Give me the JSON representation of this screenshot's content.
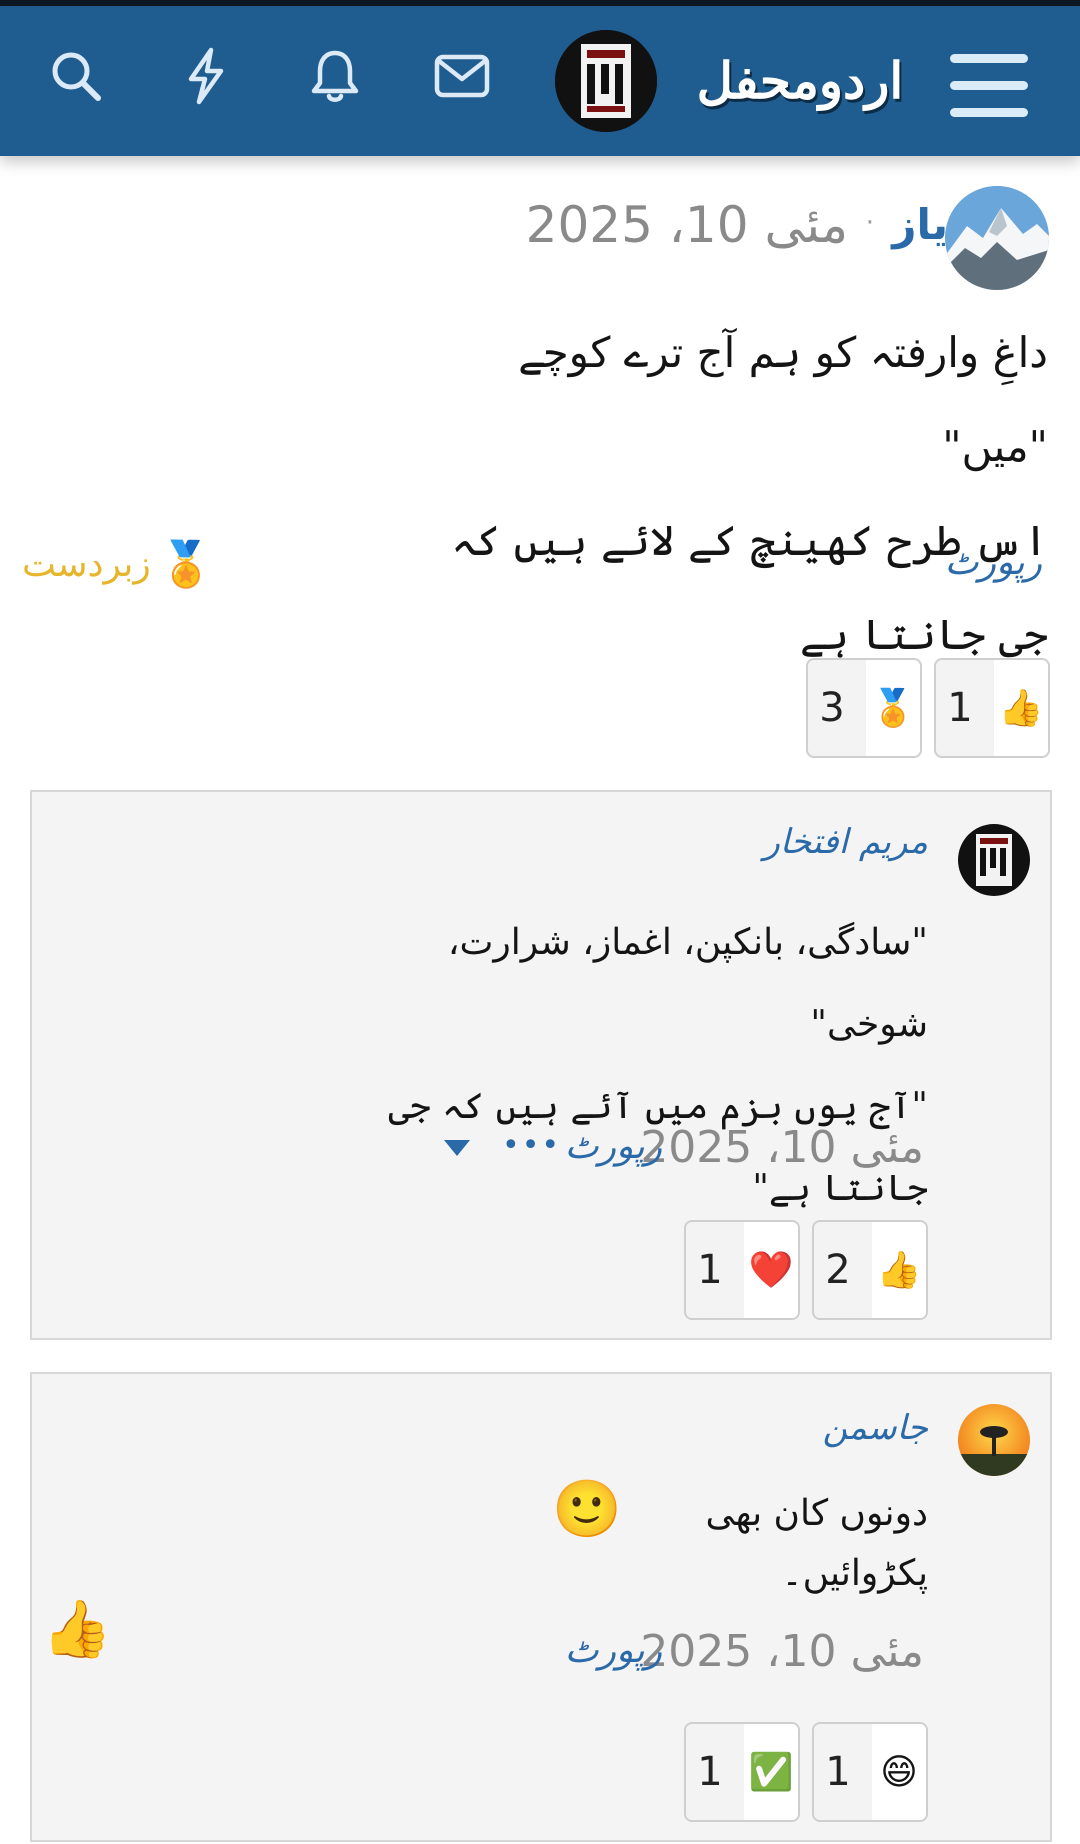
{
  "header": {
    "site_title": "اردومحفل",
    "logo_alt": "اردو محفل لوگو",
    "icons": [
      "search-icon",
      "lightning-icon",
      "bell-icon",
      "mail-icon",
      "menu-icon"
    ],
    "colors": {
      "bar": "#1f5c8f",
      "menu_lines": "#d9ecf8"
    }
  },
  "post": {
    "author": "یاز",
    "separator": "·",
    "date": "مئی 10، 2025",
    "lines": [
      "داغِ وارفتہ کو ہم آج ترے کوچے \"میں\"",
      "اس طرح کھینچ کے لائے ہیں کہ جی جانتا ہے"
    ],
    "report": "رپورٹ",
    "reaction_given": {
      "icon": "medal-icon",
      "label": "زبردست",
      "color": "#e7b52b"
    },
    "reactions": [
      {
        "icon": "thumbs-up-icon",
        "emoji": "👍",
        "count": "1"
      },
      {
        "icon": "medal-icon",
        "emoji": "🏅",
        "count": "3"
      }
    ]
  },
  "comments": [
    {
      "author": "مریم افتخار",
      "lines": [
        "\"سادگی، بانکپن، اغماز، شرارت، شوخی\"",
        "\"آج یوں بزم میں آئے ہیں کہ جی جانتا ہے\""
      ],
      "date": "مئی 10، 2025",
      "report": "رپورٹ",
      "more": "•••",
      "reactions": [
        {
          "icon": "thumbs-up-icon",
          "emoji": "👍",
          "count": "2"
        },
        {
          "icon": "heart-icon",
          "emoji": "❤️",
          "count": "1"
        }
      ]
    },
    {
      "author": "جاسمن",
      "lines": [
        "دونوں کان بھی پکڑوائیں۔"
      ],
      "inline_emoji": "🙂",
      "date": "مئی 10، 2025",
      "report": "رپورٹ",
      "like_emoji": "👍",
      "reactions": [
        {
          "icon": "grin-icon",
          "emoji": "😄",
          "count": "1"
        },
        {
          "icon": "check-icon",
          "emoji": "✅",
          "count": "1"
        }
      ]
    }
  ]
}
